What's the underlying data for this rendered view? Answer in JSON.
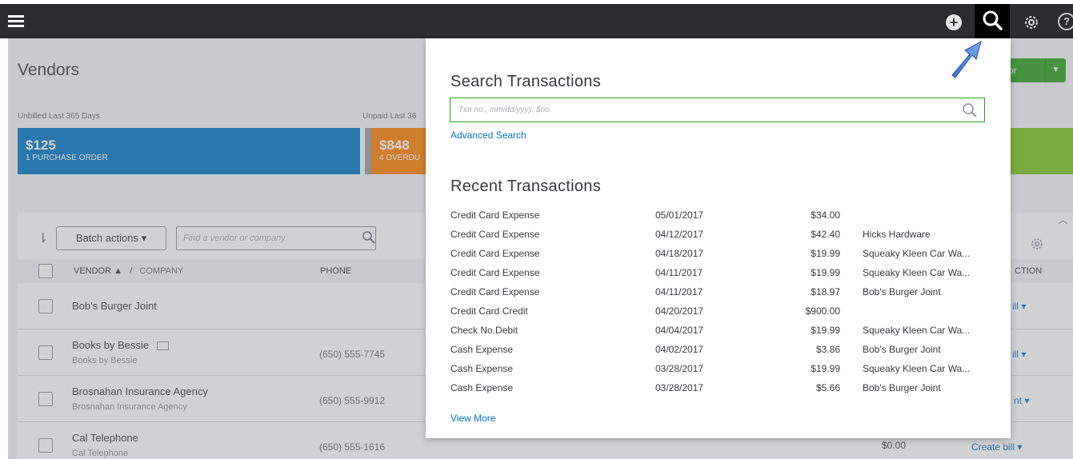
{
  "topbar": {
    "menu_icon": "hamburger-menu-icon",
    "create_icon": "plus-circle-icon",
    "search_icon": "search-icon",
    "settings_icon": "gear-icon",
    "help_label": "?"
  },
  "page": {
    "title": "Vendors",
    "new_vendor_label": "or",
    "kpi": {
      "unbilled_label": "Unbilled Last 365 Days",
      "unpaid_label": "Unpaid Last 36",
      "blue_amount": "$125",
      "blue_sub": "1 PURCHASE ORDER",
      "orange_amount": "$848",
      "orange_sub": "4 OVERDU"
    },
    "batch_actions_label": "Batch actions ▾",
    "vendor_search_placeholder": "Find a vendor or company",
    "columns": {
      "vendor": "VENDOR ▲",
      "sep": "/",
      "company": "COMPANY",
      "phone": "PHONE",
      "action": "CTION"
    },
    "rows": [
      {
        "name": "Bob's Burger Joint",
        "sub": "",
        "phone": "",
        "action": "ill ▾",
        "balance": ""
      },
      {
        "name": "Books by Bessie",
        "sub": "Books by Bessie",
        "phone": "(650) 555-7745",
        "action": "ill ▾",
        "balance": ""
      },
      {
        "name": "Brosnahan Insurance Agency",
        "sub": "Brosnahan Insurance Agency",
        "phone": "(650) 555-9912",
        "action": "nt ▾",
        "balance": ""
      },
      {
        "name": "Cal Telephone",
        "sub": "Cal Telephone",
        "phone": "(650) 555-1616",
        "action": "Create bill ▾",
        "balance": "$0.00"
      }
    ]
  },
  "search_panel": {
    "title": "Search Transactions",
    "placeholder": "Txn no., mm/dd/yyyy, $no.",
    "advanced_search": "Advanced Search",
    "recent_title": "Recent Transactions",
    "view_more": "View More",
    "transactions": [
      {
        "type": "Credit Card Expense",
        "date": "05/01/2017",
        "amount": "$34.00",
        "payee": ""
      },
      {
        "type": "Credit Card Expense",
        "date": "04/12/2017",
        "amount": "$42.40",
        "payee": "Hicks Hardware"
      },
      {
        "type": "Credit Card Expense",
        "date": "04/18/2017",
        "amount": "$19.99",
        "payee": "Squeaky Kleen Car Wa..."
      },
      {
        "type": "Credit Card Expense",
        "date": "04/11/2017",
        "amount": "$19.99",
        "payee": "Squeaky Kleen Car Wa..."
      },
      {
        "type": "Credit Card Expense",
        "date": "04/11/2017",
        "amount": "$18.97",
        "payee": "Bob's Burger Joint"
      },
      {
        "type": "Credit Card Credit",
        "date": "04/20/2017",
        "amount": "$900.00",
        "payee": ""
      },
      {
        "type": "Check No.Debit",
        "date": "04/04/2017",
        "amount": "$19.99",
        "payee": "Squeaky Kleen Car Wa..."
      },
      {
        "type": "Cash Expense",
        "date": "04/02/2017",
        "amount": "$3.86",
        "payee": "Bob's Burger Joint"
      },
      {
        "type": "Cash Expense",
        "date": "03/28/2017",
        "amount": "$19.99",
        "payee": "Squeaky Kleen Car Wa..."
      },
      {
        "type": "Cash Expense",
        "date": "03/28/2017",
        "amount": "$5.66",
        "payee": "Bob's Burger Joint"
      }
    ]
  },
  "colors": {
    "topbar": "#2b2c2e",
    "accent_green": "#2ca01c",
    "link_blue": "#0077c5",
    "kpi_blue": "#0077c5",
    "kpi_orange": "#ff8000",
    "kpi_green": "#7cc61a"
  }
}
